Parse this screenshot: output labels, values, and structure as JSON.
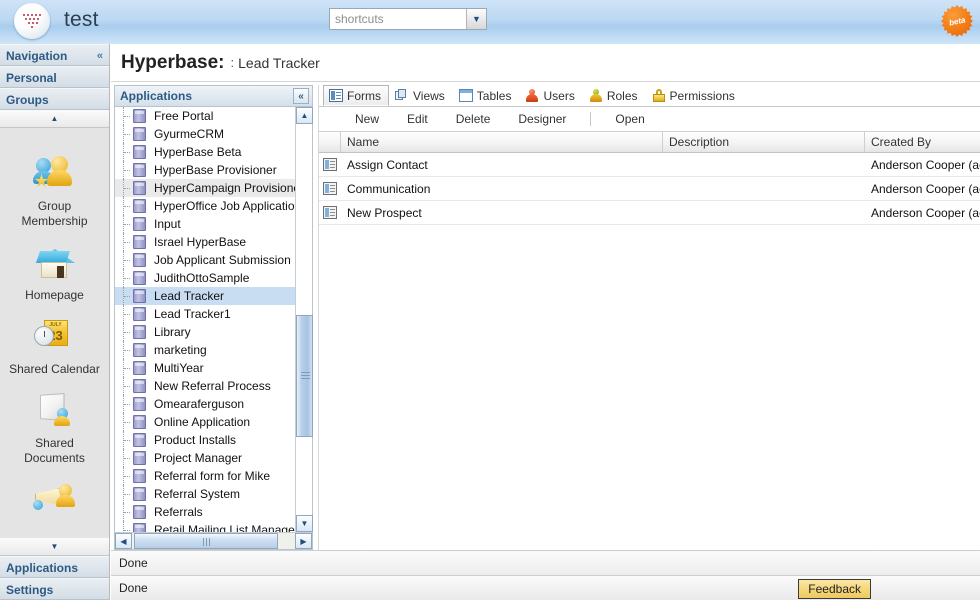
{
  "topbar": {
    "logo_icon": "hyperoffice-logo-icon",
    "app_title": "test",
    "shortcuts_placeholder": "shortcuts",
    "shortcuts_value": "",
    "dropdown_icon": "chevron-down-icon",
    "beta_label": "beta"
  },
  "sidebar": {
    "sections": [
      {
        "label": "Navigation",
        "collapse_icon": "chevron-double-left-icon"
      },
      {
        "label": "Personal"
      },
      {
        "label": "Groups"
      }
    ],
    "scroll_up_icon": "triangle-up-icon",
    "scroll_down_icon": "triangle-down-icon",
    "items": [
      {
        "label": "Group Membership",
        "icon": "group-membership-icon"
      },
      {
        "label": "Homepage",
        "icon": "home-icon"
      },
      {
        "label": "Shared Calendar",
        "icon": "calendar-icon"
      },
      {
        "label": "Shared Documents",
        "icon": "documents-icon"
      },
      {
        "label": "",
        "icon": "announcements-icon"
      }
    ],
    "bottom_sections": [
      {
        "label": "Applications"
      },
      {
        "label": "Settings"
      }
    ]
  },
  "header": {
    "title": "Hyperbase:",
    "separator": ":",
    "subtitle": "Lead Tracker"
  },
  "apps_panel": {
    "title": "Applications",
    "collapse_icon": "chevron-double-left-icon",
    "scroll_up_icon": "chevron-up-icon",
    "scroll_down_icon": "chevron-down-icon",
    "scroll_left_icon": "chevron-left-icon",
    "scroll_right_icon": "chevron-right-icon",
    "item_icon": "database-icon",
    "items": [
      {
        "label": "Free Portal",
        "state": "normal"
      },
      {
        "label": "GyurmeCRM",
        "state": "normal"
      },
      {
        "label": "HyperBase Beta",
        "state": "normal"
      },
      {
        "label": "HyperBase Provisioner",
        "state": "normal"
      },
      {
        "label": "HyperCampaign Provisioner",
        "state": "hover"
      },
      {
        "label": "HyperOffice Job Application",
        "state": "normal"
      },
      {
        "label": "Input",
        "state": "normal"
      },
      {
        "label": "Israel HyperBase",
        "state": "normal"
      },
      {
        "label": "Job Applicant Submission",
        "state": "normal"
      },
      {
        "label": "JudithOttoSample",
        "state": "normal"
      },
      {
        "label": "Lead Tracker",
        "state": "selected"
      },
      {
        "label": "Lead Tracker1",
        "state": "normal"
      },
      {
        "label": "Library",
        "state": "normal"
      },
      {
        "label": "marketing",
        "state": "normal"
      },
      {
        "label": "MultiYear",
        "state": "normal"
      },
      {
        "label": "New Referral Process",
        "state": "normal"
      },
      {
        "label": "Omearaferguson",
        "state": "normal"
      },
      {
        "label": "Online Application",
        "state": "normal"
      },
      {
        "label": "Product Installs",
        "state": "normal"
      },
      {
        "label": "Project Manager",
        "state": "normal"
      },
      {
        "label": "Referral form for Mike",
        "state": "normal"
      },
      {
        "label": "Referral System",
        "state": "normal"
      },
      {
        "label": "Referrals",
        "state": "normal"
      },
      {
        "label": "Retail Mailing List Manager",
        "state": "normal"
      }
    ]
  },
  "main": {
    "tabs": [
      {
        "label": "Forms",
        "icon": "forms-icon",
        "active": true
      },
      {
        "label": "Views",
        "icon": "views-icon",
        "active": false
      },
      {
        "label": "Tables",
        "icon": "tables-icon",
        "active": false
      },
      {
        "label": "Users",
        "icon": "users-icon",
        "active": false
      },
      {
        "label": "Roles",
        "icon": "roles-icon",
        "active": false
      },
      {
        "label": "Permissions",
        "icon": "lock-icon",
        "active": false
      }
    ],
    "toolbar": [
      {
        "label": "New"
      },
      {
        "label": "Edit"
      },
      {
        "label": "Delete"
      },
      {
        "label": "Designer"
      },
      {
        "label": "Open"
      }
    ],
    "grid": {
      "columns": [
        "",
        "Name",
        "Description",
        "Created By"
      ],
      "row_icon": "form-icon",
      "rows": [
        {
          "name": "Assign Contact",
          "description": "",
          "created_by": "Anderson Cooper (acooper"
        },
        {
          "name": "Communication",
          "description": "",
          "created_by": "Anderson Cooper (acooper"
        },
        {
          "name": "New Prospect",
          "description": "",
          "created_by": "Anderson Cooper (acooper"
        }
      ]
    }
  },
  "status": {
    "line1": "Done",
    "line2": "Done",
    "feedback_label": "Feedback"
  }
}
